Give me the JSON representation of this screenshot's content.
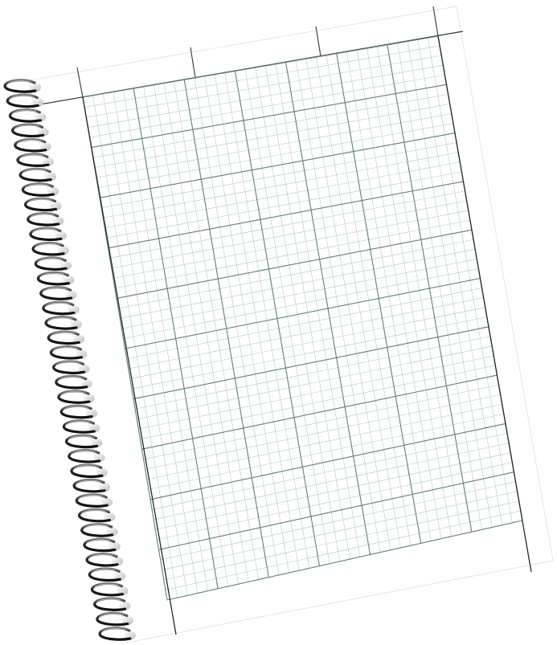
{
  "notebook": {
    "kind": "spiral-bound graph paper notebook",
    "ring_count": 38,
    "grid": {
      "major_columns": 7,
      "major_rows": 10,
      "minor_per_major": 5
    },
    "header_columns": 3,
    "colors": {
      "page_background": "#ffffff",
      "grid_minor": "#a9c4bb",
      "grid_major": "#5f7f74",
      "page_edge": "#1f2a27",
      "ring_dark": "#2d2d2d",
      "ring_light": "#c8c8c8"
    }
  }
}
